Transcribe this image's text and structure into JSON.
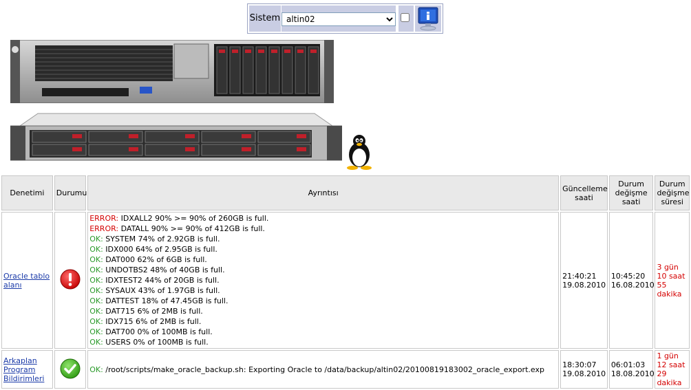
{
  "topbar": {
    "label": "Sistem",
    "selected_system": "altin02",
    "icons": {
      "dropdown": "chevron-down-icon",
      "info": "info-monitor-icon"
    }
  },
  "images": {
    "server1": "server-2u-icon",
    "server2": "server-1u-icon",
    "os": "linux-tux-icon"
  },
  "table": {
    "headers": {
      "check": "Denetimi",
      "status": "Durumu",
      "details": "Ayrıntısı",
      "updated": "Güncelleme saati",
      "changed": "Durum değişme saati",
      "duration": "Durum değişme süresi"
    },
    "rows": [
      {
        "name": "Oracle tablo alanı",
        "status_icon": "error-icon",
        "details": [
          {
            "prefix": "ERROR:",
            "text": " IDXALL2 90% >= 90% of 260GB is full.",
            "level": "error"
          },
          {
            "prefix": "ERROR:",
            "text": " DATALL 90% >= 90% of 412GB is full.",
            "level": "error"
          },
          {
            "prefix": "OK:",
            "text": " SYSTEM 74% of 2.92GB is full.",
            "level": "ok"
          },
          {
            "prefix": "OK:",
            "text": " IDX000 64% of 2.95GB is full.",
            "level": "ok"
          },
          {
            "prefix": "OK:",
            "text": " DAT000 62% of 6GB is full.",
            "level": "ok"
          },
          {
            "prefix": "OK:",
            "text": " UNDOTBS2 48% of 40GB is full.",
            "level": "ok"
          },
          {
            "prefix": "OK:",
            "text": " IDXTEST2 44% of 20GB is full.",
            "level": "ok"
          },
          {
            "prefix": "OK:",
            "text": " SYSAUX 43% of 1.97GB is full.",
            "level": "ok"
          },
          {
            "prefix": "OK:",
            "text": " DATTEST 18% of 47.45GB is full.",
            "level": "ok"
          },
          {
            "prefix": "OK:",
            "text": " DAT715 6% of 2MB is full.",
            "level": "ok"
          },
          {
            "prefix": "OK:",
            "text": " IDX715 6% of 2MB is full.",
            "level": "ok"
          },
          {
            "prefix": "OK:",
            "text": " DAT700 0% of 100MB is full.",
            "level": "ok"
          },
          {
            "prefix": "OK:",
            "text": " USERS 0% of 100MB is full.",
            "level": "ok"
          }
        ],
        "updated_time": "21:40:21",
        "updated_date": "19.08.2010",
        "changed_time": "10:45:20",
        "changed_date": "16.08.2010",
        "duration": "3 gün 10 saat 55 dakika"
      },
      {
        "name": "Arkaplan Program Bildirimleri",
        "status_icon": "ok-check-icon",
        "details": [
          {
            "prefix": "OK:",
            "text": " /root/scripts/make_oracle_backup.sh: Exporting Oracle to /data/backup/altin02/20100819183002_oracle_export.exp",
            "level": "ok"
          }
        ],
        "updated_time": "18:30:07",
        "updated_date": "19.08.2010",
        "changed_time": "06:01:03",
        "changed_date": "18.08.2010",
        "duration": "1 gün 12 saat 29 dakika"
      }
    ]
  },
  "colors": {
    "ok": "#2a9a2a",
    "error": "#d40000",
    "link": "#1a3aa8",
    "topbar_bg": "#c9cde3"
  }
}
